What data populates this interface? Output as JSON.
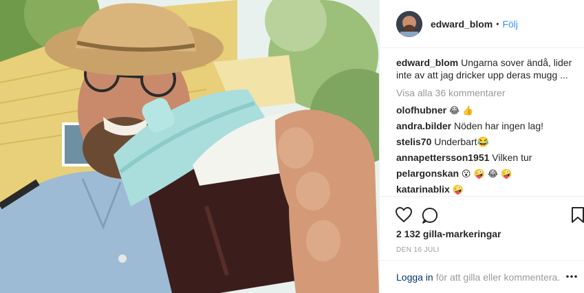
{
  "post": {
    "username": "edward_blom",
    "follow_label": "Följ",
    "separator": "•",
    "caption_text": "Ungarna sover ändå, lider inte av att jag dricker upp deras mugg ...",
    "view_all_label": "Visa alla 36 kommentarer",
    "comments": [
      {
        "user": "olofhubner",
        "text": "😂 👍"
      },
      {
        "user": "andra.bilder",
        "text": "Nöden har ingen lag!"
      },
      {
        "user": "stelis70",
        "text": "Underbart😂"
      },
      {
        "user": "annapettersson1951",
        "text": "Vilken tur"
      },
      {
        "user": "pelargonskan",
        "text": "😮 🤪 😂 🤪"
      },
      {
        "user": "katarinablix",
        "text": "🤪"
      }
    ],
    "likes_label": "2 132 gilla-markeringar",
    "date_label": "DEN 16 JULI",
    "login_label": "Logga in",
    "login_rest": "för att gilla eller kommentera.",
    "icons": {
      "like": "heart-icon",
      "comment": "speech-bubble-icon",
      "save": "bookmark-icon",
      "more": "more-dots-icon"
    },
    "colors": {
      "link": "#3897f0",
      "text": "#262626",
      "muted": "#999999",
      "login": "#003569"
    }
  }
}
